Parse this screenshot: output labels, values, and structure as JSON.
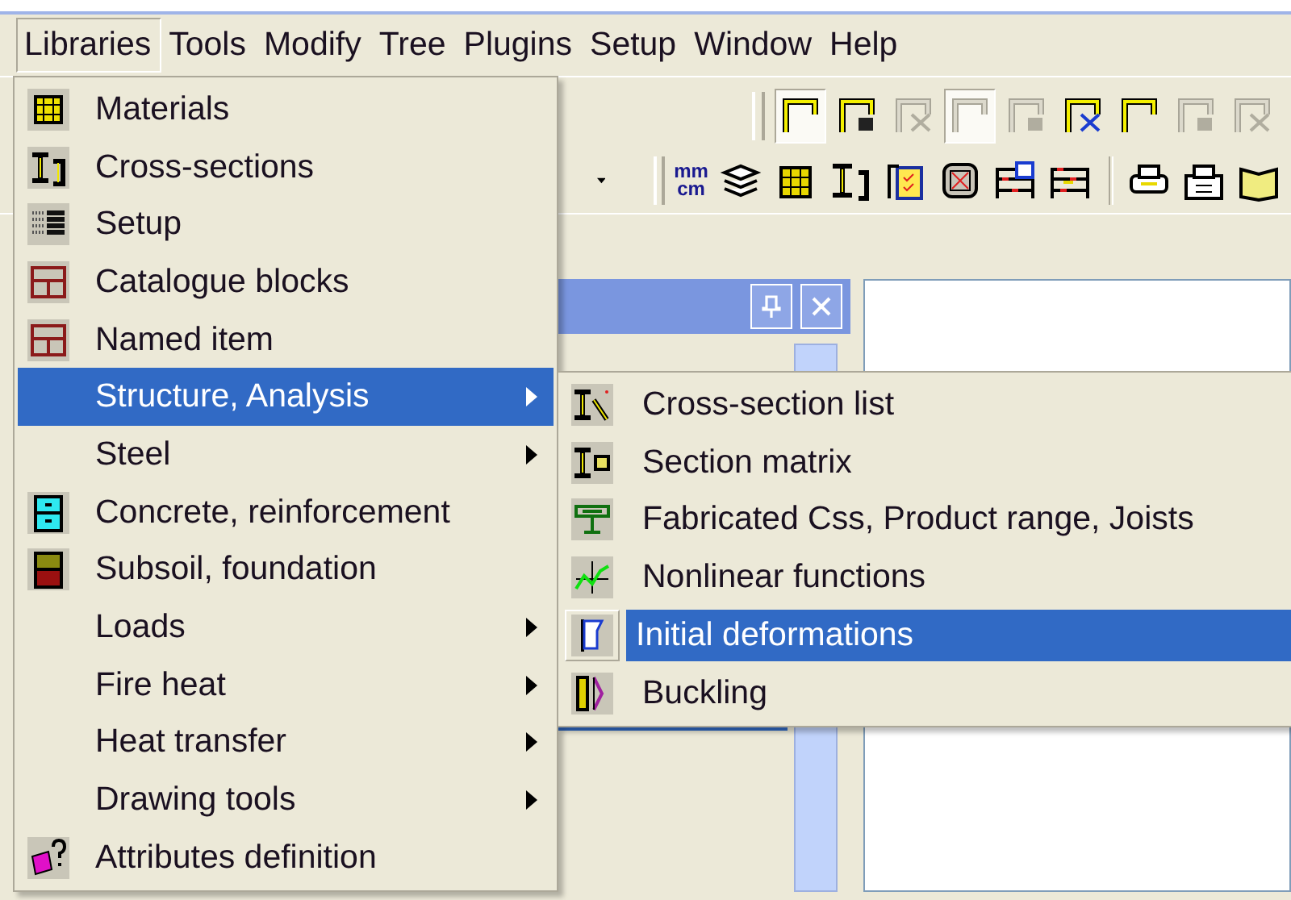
{
  "menu_bar": [
    {
      "label": "Libraries",
      "selected": true
    },
    {
      "label": "Tools",
      "selected": false
    },
    {
      "label": "Modify",
      "selected": false
    },
    {
      "label": "Tree",
      "selected": false
    },
    {
      "label": "Plugins",
      "selected": false
    },
    {
      "label": "Setup",
      "selected": false
    },
    {
      "label": "Window",
      "selected": false
    },
    {
      "label": "Help",
      "selected": false
    }
  ],
  "toolbar_1": [
    {
      "pressed": true,
      "disabled": false
    },
    {
      "pressed": false,
      "disabled": false
    },
    {
      "pressed": false,
      "disabled": true
    },
    {
      "pressed": true,
      "disabled": true
    },
    {
      "pressed": false,
      "disabled": true
    },
    {
      "pressed": false,
      "disabled": false
    },
    {
      "pressed": false,
      "disabled": false
    },
    {
      "pressed": false,
      "disabled": true
    },
    {
      "pressed": false,
      "disabled": true
    }
  ],
  "units_button": {
    "top": "mm",
    "bottom": "cm"
  },
  "libraries_menu": {
    "items": [
      {
        "label": "Materials",
        "submenu": false,
        "selected": false
      },
      {
        "label": "Cross-sections",
        "submenu": false,
        "selected": false
      },
      {
        "label": "Setup",
        "submenu": false,
        "selected": false
      },
      {
        "label": "Catalogue blocks",
        "submenu": false,
        "selected": false
      },
      {
        "label": "Named item",
        "submenu": false,
        "selected": false
      },
      {
        "label": "Structure, Analysis",
        "submenu": true,
        "selected": true
      },
      {
        "label": "Steel",
        "submenu": true,
        "selected": false
      },
      {
        "label": "Concrete, reinforcement",
        "submenu": false,
        "selected": false
      },
      {
        "label": "Subsoil, foundation",
        "submenu": false,
        "selected": false
      },
      {
        "label": "Loads",
        "submenu": true,
        "selected": false
      },
      {
        "label": "Fire heat",
        "submenu": true,
        "selected": false
      },
      {
        "label": "Heat transfer",
        "submenu": true,
        "selected": false
      },
      {
        "label": "Drawing tools",
        "submenu": true,
        "selected": false
      },
      {
        "label": "Attributes definition",
        "submenu": false,
        "selected": false
      }
    ]
  },
  "structure_submenu": {
    "items": [
      {
        "label": "Cross-section list",
        "selected": false
      },
      {
        "label": "Section matrix",
        "selected": false
      },
      {
        "label": "Fabricated Css, Product range, Joists",
        "selected": false
      },
      {
        "label": "Nonlinear functions",
        "selected": false
      },
      {
        "label": "Initial deformations",
        "selected": true
      },
      {
        "label": "Buckling",
        "selected": false
      }
    ]
  }
}
